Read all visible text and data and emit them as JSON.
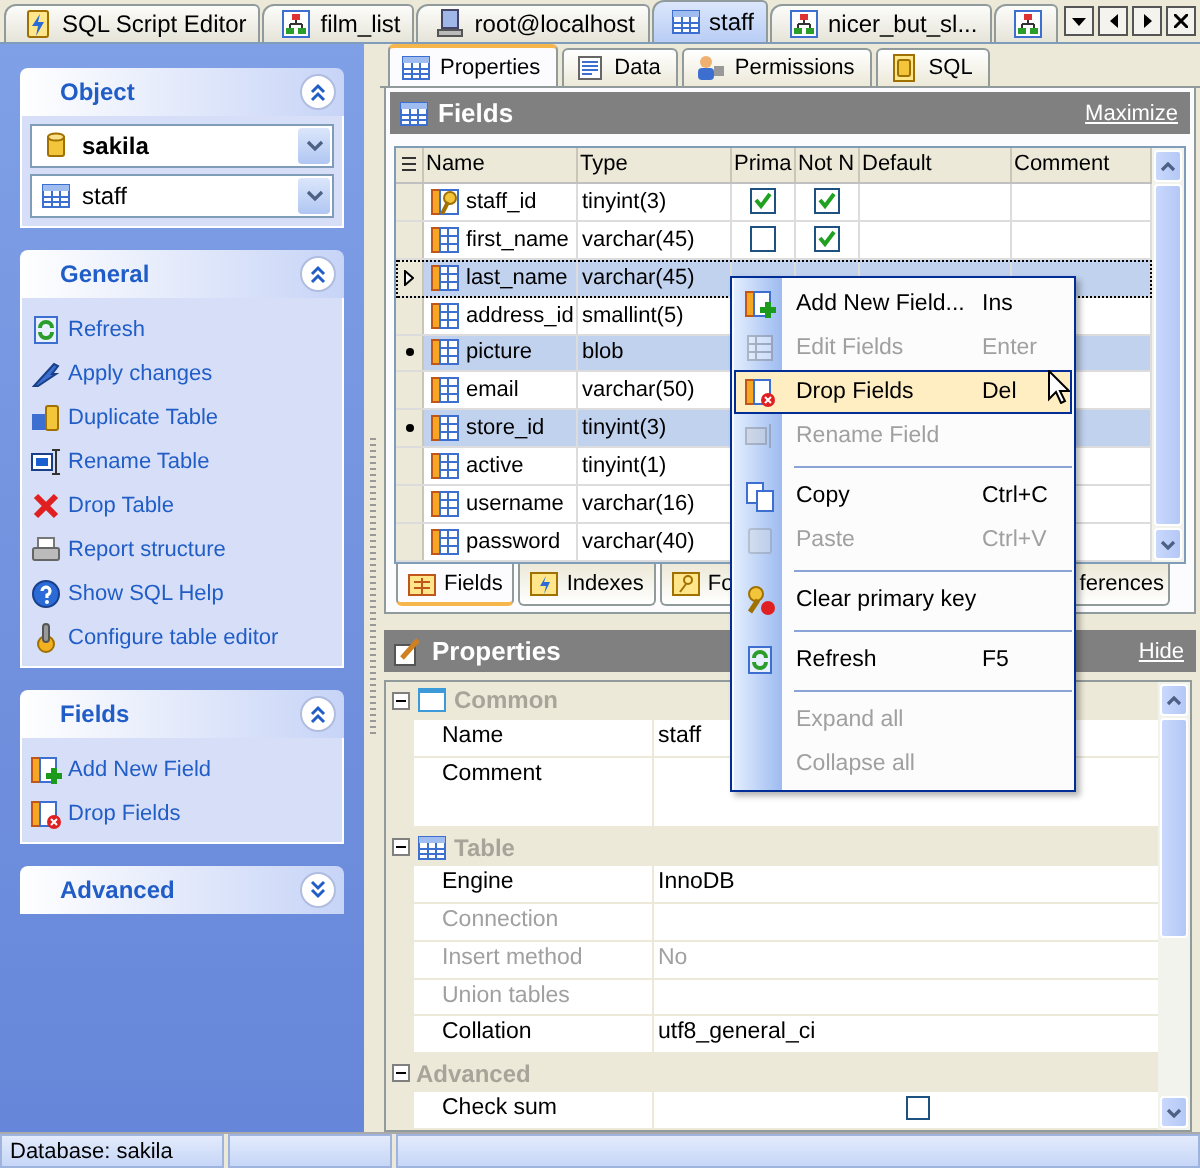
{
  "document_tabs": [
    {
      "label": "SQL Script Editor",
      "selected": false
    },
    {
      "label": "film_list",
      "selected": false
    },
    {
      "label": "root@localhost",
      "selected": false
    },
    {
      "label": "staff",
      "selected": true
    },
    {
      "label": "nicer_but_sl...",
      "selected": false
    },
    {
      "selected": false
    }
  ],
  "sidebar": {
    "panels": [
      {
        "title": "Object",
        "expanded": true,
        "kind": "selectors",
        "selectors": [
          {
            "value": "sakila"
          },
          {
            "value": "staff"
          }
        ]
      },
      {
        "title": "General",
        "expanded": true,
        "kind": "links",
        "items": [
          "Refresh",
          "Apply changes",
          "Duplicate Table",
          "Rename Table",
          "Drop Table",
          "Report structure",
          "Show SQL Help",
          "Configure table editor"
        ]
      },
      {
        "title": "Fields",
        "expanded": true,
        "kind": "links",
        "items": [
          "Add New Field",
          "Drop Fields"
        ]
      },
      {
        "title": "Advanced",
        "expanded": false
      }
    ]
  },
  "editor_tabs": [
    {
      "label": "Properties",
      "selected": true
    },
    {
      "label": "Data",
      "selected": false
    },
    {
      "label": "Permissions",
      "selected": false
    },
    {
      "label": "SQL",
      "selected": false
    }
  ],
  "fields_panel": {
    "title": "Fields",
    "action": "Maximize",
    "columns": [
      "Name",
      "Type",
      "Prima",
      "Not N",
      "Default",
      "Comment"
    ],
    "rows": [
      {
        "name": "staff_id",
        "type": "tinyint(3)",
        "primary": true,
        "not_null": true,
        "selected": false,
        "current": false
      },
      {
        "name": "first_name",
        "type": "varchar(45)",
        "primary": false,
        "not_null": true,
        "selected": false,
        "current": false
      },
      {
        "name": "last_name",
        "type": "varchar(45)",
        "selected": true,
        "current": true
      },
      {
        "name": "address_id",
        "type": "smallint(5)",
        "selected": false,
        "current": false
      },
      {
        "name": "picture",
        "type": "blob",
        "selected": true,
        "current": false
      },
      {
        "name": "email",
        "type": "varchar(50)",
        "selected": false,
        "current": false
      },
      {
        "name": "store_id",
        "type": "tinyint(3)",
        "selected": true,
        "current": false
      },
      {
        "name": "active",
        "type": "tinyint(1)",
        "selected": false,
        "current": false
      },
      {
        "name": "username",
        "type": "varchar(16)",
        "selected": false,
        "current": false
      },
      {
        "name": "password",
        "type": "varchar(40)",
        "selected": false,
        "current": false
      }
    ],
    "tabs": [
      {
        "label": "Fields",
        "selected": true
      },
      {
        "label": "Indexes",
        "selected": false
      },
      {
        "label": "Fo",
        "selected": false
      },
      {
        "label": "ferences",
        "selected": false
      }
    ]
  },
  "context_menu": [
    {
      "kind": "item",
      "label": "Add New Field...",
      "shortcut": "Ins",
      "disabled": false,
      "highlighted": false
    },
    {
      "kind": "item",
      "label": "Edit Fields",
      "shortcut": "Enter",
      "disabled": true,
      "highlighted": false
    },
    {
      "kind": "item",
      "label": "Drop Fields",
      "shortcut": "Del",
      "disabled": false,
      "highlighted": true
    },
    {
      "kind": "item",
      "label": "Rename Field",
      "disabled": true,
      "highlighted": false
    },
    {
      "kind": "separator"
    },
    {
      "kind": "item",
      "label": "Copy",
      "shortcut": "Ctrl+C",
      "disabled": false,
      "highlighted": false
    },
    {
      "kind": "item",
      "label": "Paste",
      "shortcut": "Ctrl+V",
      "disabled": true,
      "highlighted": false
    },
    {
      "kind": "separator"
    },
    {
      "kind": "item",
      "label": "Clear primary key",
      "disabled": false,
      "highlighted": false
    },
    {
      "kind": "separator"
    },
    {
      "kind": "item",
      "label": "Refresh",
      "shortcut": "F5",
      "disabled": false,
      "highlighted": false
    },
    {
      "kind": "separator"
    },
    {
      "kind": "item",
      "label": "Expand all",
      "disabled": true,
      "highlighted": false
    },
    {
      "kind": "item",
      "label": "Collapse all",
      "disabled": true,
      "highlighted": false
    }
  ],
  "properties": {
    "title": "Properties",
    "action": "Hide",
    "groups": [
      {
        "title": "Common",
        "expanded": true,
        "rows": [
          {
            "kind": "text",
            "label": "Name",
            "value": "staff",
            "disabled": false
          },
          {
            "kind": "memo",
            "label": "Comment",
            "disabled": false
          }
        ]
      },
      {
        "title": "Table",
        "expanded": true,
        "rows": [
          {
            "kind": "text",
            "label": "Engine",
            "value": "InnoDB",
            "disabled": false
          },
          {
            "kind": "text",
            "label": "Connection",
            "disabled": true
          },
          {
            "kind": "text",
            "label": "Insert method",
            "value": "No",
            "disabled": true
          },
          {
            "kind": "text",
            "label": "Union tables",
            "disabled": true
          },
          {
            "kind": "text",
            "label": "Collation",
            "value": "utf8_general_ci",
            "disabled": false
          }
        ]
      },
      {
        "title": "Advanced",
        "expanded": true,
        "rows": [
          {
            "kind": "checkbox",
            "label": "Check sum",
            "checked": false,
            "disabled": false
          }
        ]
      }
    ]
  },
  "status_bar": [
    "Database: sakila"
  ]
}
